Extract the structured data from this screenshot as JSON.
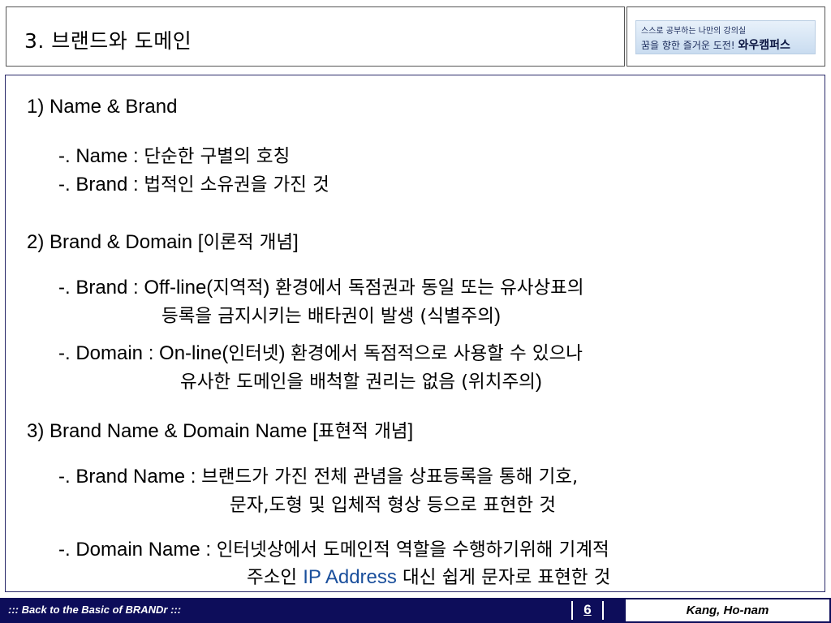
{
  "title": "3. 브랜드와 도메인",
  "logo": {
    "line1": "스스로 공부하는 나만의 강의실",
    "line2": "꿈을 향한 즐거운 도전!",
    "brand": "와우캠퍼스"
  },
  "sections": [
    {
      "heading": "1) Name & Brand",
      "items": [
        {
          "label": "-. Name : ",
          "text": "단순한 구별의 호칭"
        },
        {
          "label": "-. Brand : ",
          "text": "법적인 소유권을 가진 것"
        }
      ]
    },
    {
      "heading_main": "2) Brand & Domain [",
      "heading_ko": "이론적 개념",
      "heading_end": "]",
      "items": [
        {
          "label": "-. Brand : Off-line(",
          "paren": "지역적",
          "label_end": ") ",
          "text": "환경에서 독점권과 동일 또는 유사상표의",
          "line2_ko": "등록을 금지시키는 배타권이 발생 (",
          "line2_paren": "식별주의",
          "line2_end": ")"
        },
        {
          "label": "-. Domain : On-line(",
          "paren": "인터넷",
          "label_end": ") ",
          "text": "환경에서 독점적으로 사용할 수 있으나",
          "line2_ko": "유사한 도메인을 배척할 권리는 없음 (",
          "line2_paren": "위치주의",
          "line2_end": ")"
        }
      ]
    },
    {
      "heading_main": "3) Brand Name & Domain Name [",
      "heading_ko": "표현적 개념",
      "heading_end": "]",
      "items": [
        {
          "label": "-. Brand Name : ",
          "text": "브랜드가 가진 전체 관념을 상표등록을 통해 기호,",
          "line2": "문자,도형 및 입체적 형상 등으로 표현한 것"
        },
        {
          "label": "-. Domain Name : ",
          "text": "인터넷상에서 도메인적 역할을 수행하기위해 기계적",
          "line2_pre": "주소인 ",
          "line2_highlight": "IP Address",
          "line2_post": " 대신 쉽게 문자로 표현한 것"
        }
      ]
    }
  ],
  "footer": {
    "left": "::: Back to the Basic of  BRANDr  :::",
    "page": "6",
    "author": "Kang, Ho-nam"
  },
  "colors": {
    "footer_bg": "#0d0d5a",
    "highlight": "#1a4f9c"
  }
}
